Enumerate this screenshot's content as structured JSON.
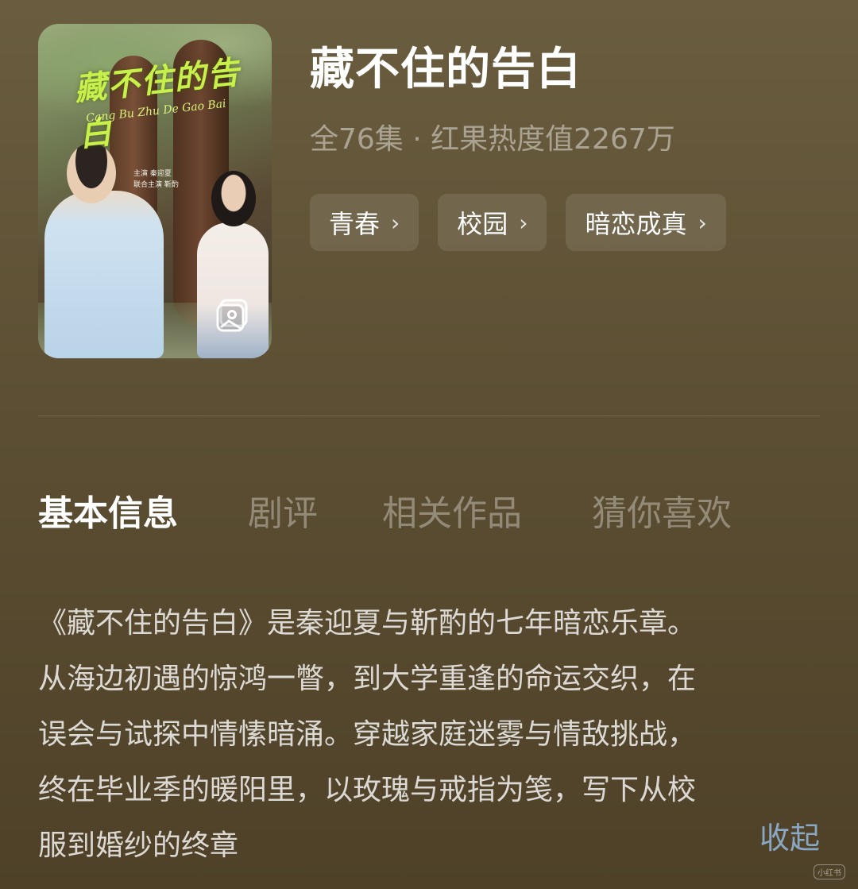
{
  "poster": {
    "art_title": "藏不住的告白",
    "art_subtitle": "Cang Bu Zhu De Gao Bai",
    "credits": [
      "主演 秦迎夏",
      "联合主演 靳酌"
    ],
    "icon": "gallery-icon"
  },
  "show": {
    "title": "藏不住的告白",
    "meta": "全76集 · 红果热度值2267万"
  },
  "tags": [
    {
      "label": "青春"
    },
    {
      "label": "校园"
    },
    {
      "label": "暗恋成真"
    }
  ],
  "tabs": [
    {
      "label": "基本信息",
      "active": true
    },
    {
      "label": "剧评",
      "active": false
    },
    {
      "label": "相关作品",
      "active": false
    },
    {
      "label": "猜你喜欢",
      "active": false
    }
  ],
  "description": {
    "lines": [
      "《藏不住的告白》是秦迎夏与靳酌的七年暗恋乐章。",
      "从海边初遇的惊鸿一瞥，到大学重逢的命运交织，在",
      "误会与试探中情愫暗涌。穿越家庭迷雾与情敌挑战，",
      "终在毕业季的暖阳里，以玫瑰与戒指为笺，写下从校",
      "服到婚纱的终章"
    ],
    "collapse_label": "收起"
  },
  "watermark": "小红书",
  "colors": {
    "accent_link": "#8aa7c4",
    "poster_title": "#c8f04a"
  }
}
